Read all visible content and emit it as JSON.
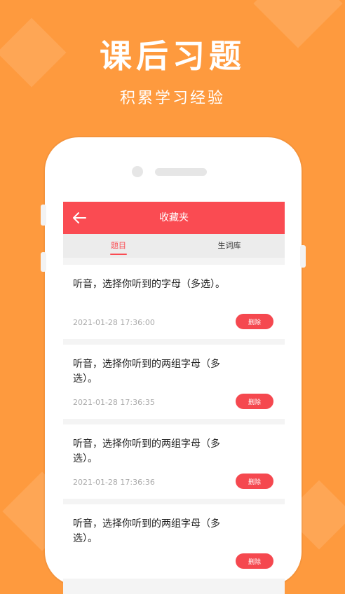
{
  "promo": {
    "title": "课后习题",
    "subtitle": "积累学习经验"
  },
  "colors": {
    "background": "#FE9A3E",
    "accent": "#FA4B52"
  },
  "header": {
    "back_icon": "arrow-left-icon",
    "title": "收藏夹"
  },
  "tabs": [
    {
      "label": "题目",
      "active": true
    },
    {
      "label": "生词库",
      "active": false
    }
  ],
  "items": [
    {
      "text": "听音，选择你听到的字母（多选）。",
      "time": "2021-01-28 17:36:00",
      "delete_label": "删除"
    },
    {
      "text": "听音，选择你听到的两组字母（多选）。",
      "time": "2021-01-28 17:36:35",
      "delete_label": "删除"
    },
    {
      "text": "听音，选择你听到的两组字母（多选）。",
      "time": "2021-01-28 17:36:36",
      "delete_label": "删除"
    },
    {
      "text": "听音，选择你听到的两组字母（多选）。",
      "time": "",
      "delete_label": "删除"
    }
  ]
}
